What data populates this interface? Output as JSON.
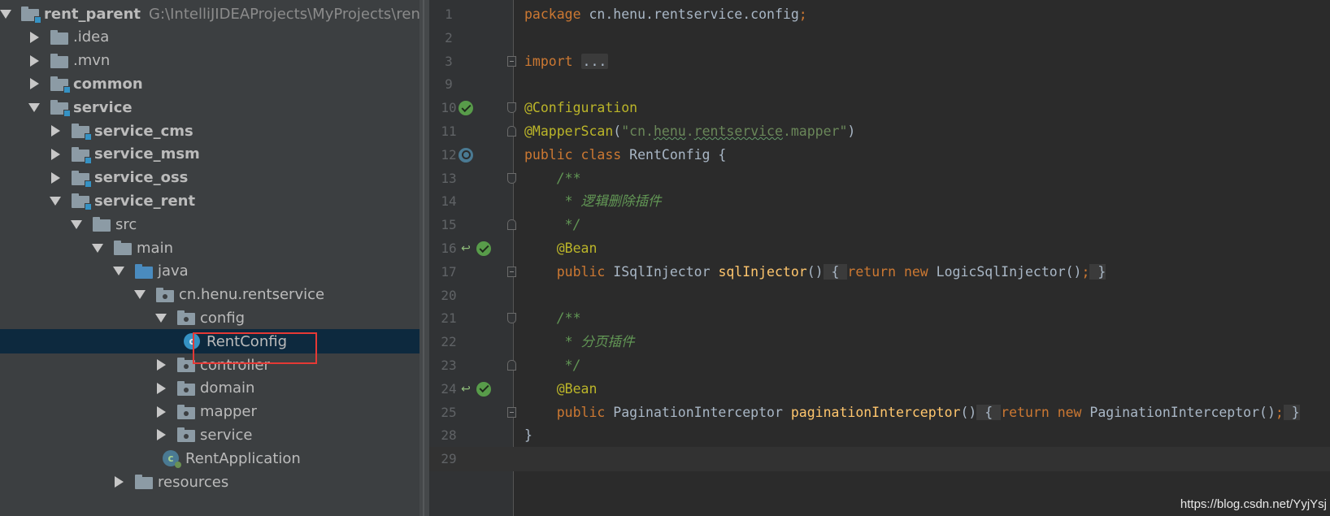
{
  "project_tree": [
    {
      "name": "tree-item-rent-parent",
      "label": "rent_parent",
      "hint": "G:\\IntelliJIDEAProjects\\MyProjects\\rent_p",
      "arrow": "down",
      "icon": "module-folder",
      "bold": true
    },
    {
      "name": "tree-item-idea",
      "label": ".idea",
      "arrow": "right",
      "icon": "folder"
    },
    {
      "name": "tree-item-mvn",
      "label": ".mvn",
      "arrow": "right",
      "icon": "folder"
    },
    {
      "name": "tree-item-common",
      "label": "common",
      "arrow": "right",
      "icon": "module-folder",
      "bold": true
    },
    {
      "name": "tree-item-service",
      "label": "service",
      "arrow": "down",
      "icon": "module-folder",
      "bold": true
    },
    {
      "name": "tree-item-service-cms",
      "label": "service_cms",
      "arrow": "right",
      "icon": "module-folder",
      "bold": true
    },
    {
      "name": "tree-item-service-msm",
      "label": "service_msm",
      "arrow": "right",
      "icon": "module-folder",
      "bold": true
    },
    {
      "name": "tree-item-service-oss",
      "label": "service_oss",
      "arrow": "right",
      "icon": "module-folder",
      "bold": true
    },
    {
      "name": "tree-item-service-rent",
      "label": "service_rent",
      "arrow": "down",
      "icon": "module-folder",
      "bold": true
    },
    {
      "name": "tree-item-src",
      "label": "src",
      "arrow": "down",
      "icon": "folder"
    },
    {
      "name": "tree-item-main",
      "label": "main",
      "arrow": "down",
      "icon": "folder"
    },
    {
      "name": "tree-item-java",
      "label": "java",
      "arrow": "down",
      "icon": "source-folder"
    },
    {
      "name": "tree-item-package",
      "label": "cn.henu.rentservice",
      "arrow": "down",
      "icon": "package"
    },
    {
      "name": "tree-item-config",
      "label": "config",
      "arrow": "down",
      "icon": "package"
    },
    {
      "name": "tree-item-rentconfig",
      "label": "RentConfig",
      "arrow": "none",
      "icon": "class",
      "selected": true
    },
    {
      "name": "tree-item-controller",
      "label": "controller",
      "arrow": "right",
      "icon": "package"
    },
    {
      "name": "tree-item-domain",
      "label": "domain",
      "arrow": "right",
      "icon": "package"
    },
    {
      "name": "tree-item-mapper",
      "label": "mapper",
      "arrow": "right",
      "icon": "package"
    },
    {
      "name": "tree-item-service-pkg",
      "label": "service",
      "arrow": "right",
      "icon": "package"
    },
    {
      "name": "tree-item-rentapplication",
      "label": "RentApplication",
      "arrow": "none",
      "icon": "spring-boot-class"
    },
    {
      "name": "tree-item-resources",
      "label": "resources",
      "arrow": "right",
      "icon": "folder"
    }
  ],
  "editor": {
    "lines": [
      {
        "num": "1",
        "tokens": [
          [
            "kw",
            "package"
          ],
          [
            "",
            " cn.henu.rentservice.config"
          ],
          [
            "kw",
            ";"
          ]
        ]
      },
      {
        "num": "2",
        "tokens": []
      },
      {
        "num": "3",
        "fold": "box",
        "tokens": [
          [
            "kw",
            "import"
          ],
          [
            "",
            " "
          ],
          [
            "folded",
            "..."
          ]
        ]
      },
      {
        "num": "9",
        "tokens": []
      },
      {
        "num": "10",
        "gutter": [
          "check"
        ],
        "fold": "start",
        "tokens": [
          [
            "ann",
            "@Configuration"
          ]
        ]
      },
      {
        "num": "11",
        "fold": "end",
        "tokens": [
          [
            "ann",
            "@MapperScan"
          ],
          [
            "",
            "("
          ],
          [
            "str",
            "\"cn."
          ],
          [
            "str typo",
            "henu"
          ],
          [
            "str",
            "."
          ],
          [
            "str typo",
            "rentservice"
          ],
          [
            "str",
            ".mapper\""
          ],
          [
            "",
            ")"
          ]
        ]
      },
      {
        "num": "12",
        "gutter": [
          "nav"
        ],
        "tokens": [
          [
            "kw",
            "public class"
          ],
          [
            "",
            " RentConfig {"
          ]
        ]
      },
      {
        "num": "13",
        "fold": "start",
        "tokens": [
          [
            "",
            "    "
          ],
          [
            "doc",
            "/**"
          ]
        ]
      },
      {
        "num": "14",
        "tokens": [
          [
            "",
            "     "
          ],
          [
            "doc",
            "* 逻辑删除插件"
          ]
        ]
      },
      {
        "num": "15",
        "fold": "end",
        "tokens": [
          [
            "",
            "     "
          ],
          [
            "doc",
            "*/"
          ]
        ]
      },
      {
        "num": "16",
        "gutter": [
          "arrow",
          "check"
        ],
        "tokens": [
          [
            "",
            "    "
          ],
          [
            "ann",
            "@Bean"
          ]
        ]
      },
      {
        "num": "17",
        "fold": "box",
        "tokens": [
          [
            "",
            "    "
          ],
          [
            "kw",
            "public"
          ],
          [
            "",
            " ISqlInjector "
          ],
          [
            "method",
            "sqlInjector"
          ],
          [
            "",
            "()"
          ],
          [
            "folded-punct",
            " { "
          ],
          [
            "kw",
            "return new"
          ],
          [
            "",
            " LogicSqlInjector()"
          ],
          [
            "kw",
            ";"
          ],
          [
            "folded-punct",
            " }"
          ]
        ]
      },
      {
        "num": "20",
        "tokens": []
      },
      {
        "num": "21",
        "fold": "start",
        "tokens": [
          [
            "",
            "    "
          ],
          [
            "doc",
            "/**"
          ]
        ]
      },
      {
        "num": "22",
        "tokens": [
          [
            "",
            "     "
          ],
          [
            "doc",
            "* 分页插件"
          ]
        ]
      },
      {
        "num": "23",
        "fold": "end",
        "tokens": [
          [
            "",
            "     "
          ],
          [
            "doc",
            "*/"
          ]
        ]
      },
      {
        "num": "24",
        "gutter": [
          "arrow",
          "check"
        ],
        "tokens": [
          [
            "",
            "    "
          ],
          [
            "ann",
            "@Bean"
          ]
        ]
      },
      {
        "num": "25",
        "fold": "box",
        "tokens": [
          [
            "",
            "    "
          ],
          [
            "kw",
            "public"
          ],
          [
            "",
            " PaginationInterceptor "
          ],
          [
            "method",
            "paginationInterceptor"
          ],
          [
            "",
            "()"
          ],
          [
            "folded-punct",
            " { "
          ],
          [
            "kw",
            "return new"
          ],
          [
            "",
            " PaginationInterceptor()"
          ],
          [
            "kw",
            ";"
          ],
          [
            "folded-punct",
            " }"
          ]
        ]
      },
      {
        "num": "28",
        "tokens": [
          [
            "",
            "}"
          ]
        ]
      },
      {
        "num": "29",
        "current": true,
        "tokens": []
      }
    ]
  },
  "watermark": "https://blog.csdn.net/YyjYsj",
  "colors": {
    "background": "#2b2b2b",
    "panel": "#3c3f41",
    "keyword": "#cc7832",
    "annotation": "#bbb529",
    "string": "#6a8759",
    "doc_comment": "#629755",
    "method": "#ffc66d",
    "selection_border": "#e53935"
  }
}
